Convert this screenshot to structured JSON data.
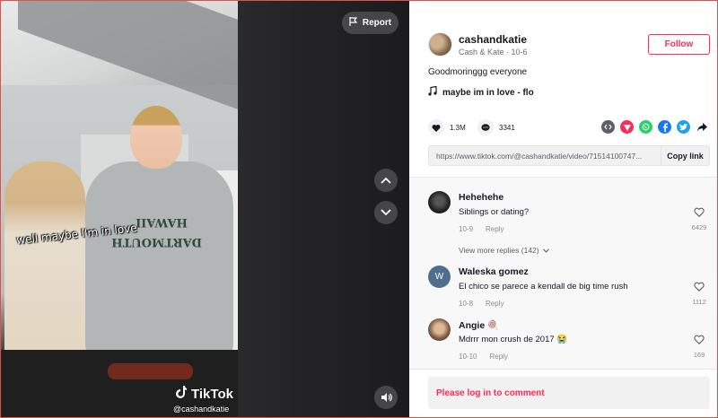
{
  "video": {
    "caption_sticker": "well maybe I'm in love",
    "hoodie_text": "DARTMOUTH HAWAII",
    "watermark": "TikTok",
    "handle": "@cashandkatie",
    "report_label": "Report"
  },
  "post": {
    "author_name": "cashandkatie",
    "author_sub": "Cash & Kate · 10-6",
    "follow_label": "Follow",
    "description": "Goodmoringgg everyone",
    "music": "maybe im in love - flo",
    "likes": "1.3M",
    "comments": "3341",
    "link": "https://www.tiktok.com/@cashandkatie/video/71514100747...",
    "copy_label": "Copy link"
  },
  "share_icons": [
    {
      "name": "embed-icon",
      "color": "#5d5f66",
      "glyph": "‹›"
    },
    {
      "name": "send-icon",
      "color": "#fe2c55",
      "glyph": "▼"
    },
    {
      "name": "whatsapp-icon",
      "color": "#25d366",
      "glyph": "☏"
    },
    {
      "name": "facebook-icon",
      "color": "#1877f2",
      "glyph": "f"
    },
    {
      "name": "twitter-icon",
      "color": "#1da1f2",
      "glyph": "t"
    },
    {
      "name": "share-arrow-icon",
      "color": "#ffffff",
      "glyph": "➦"
    }
  ],
  "comments": [
    {
      "name": "Hehehehe",
      "text": "Siblings or dating?",
      "date": "10-9",
      "reply": "Reply",
      "likes": "6429",
      "avatar_color": "#2b2b2b",
      "avatar_letter": ""
    },
    {
      "name": "Waleska gomez",
      "text": "El chico se parece a kendall de big time rush",
      "date": "10-8",
      "reply": "Reply",
      "likes": "1112",
      "avatar_color": "#4f6e8c",
      "avatar_letter": "W"
    },
    {
      "name": "Angie 🍭",
      "text": "Mdrrr mon crush de 2017 😭",
      "date": "10-10",
      "reply": "Reply",
      "likes": "169",
      "avatar_color": "#7a5a44",
      "avatar_letter": ""
    }
  ],
  "view_more": "View more replies (142)",
  "login_prompt": "Please log in to comment",
  "colors": {
    "accent": "#fe2c55"
  }
}
